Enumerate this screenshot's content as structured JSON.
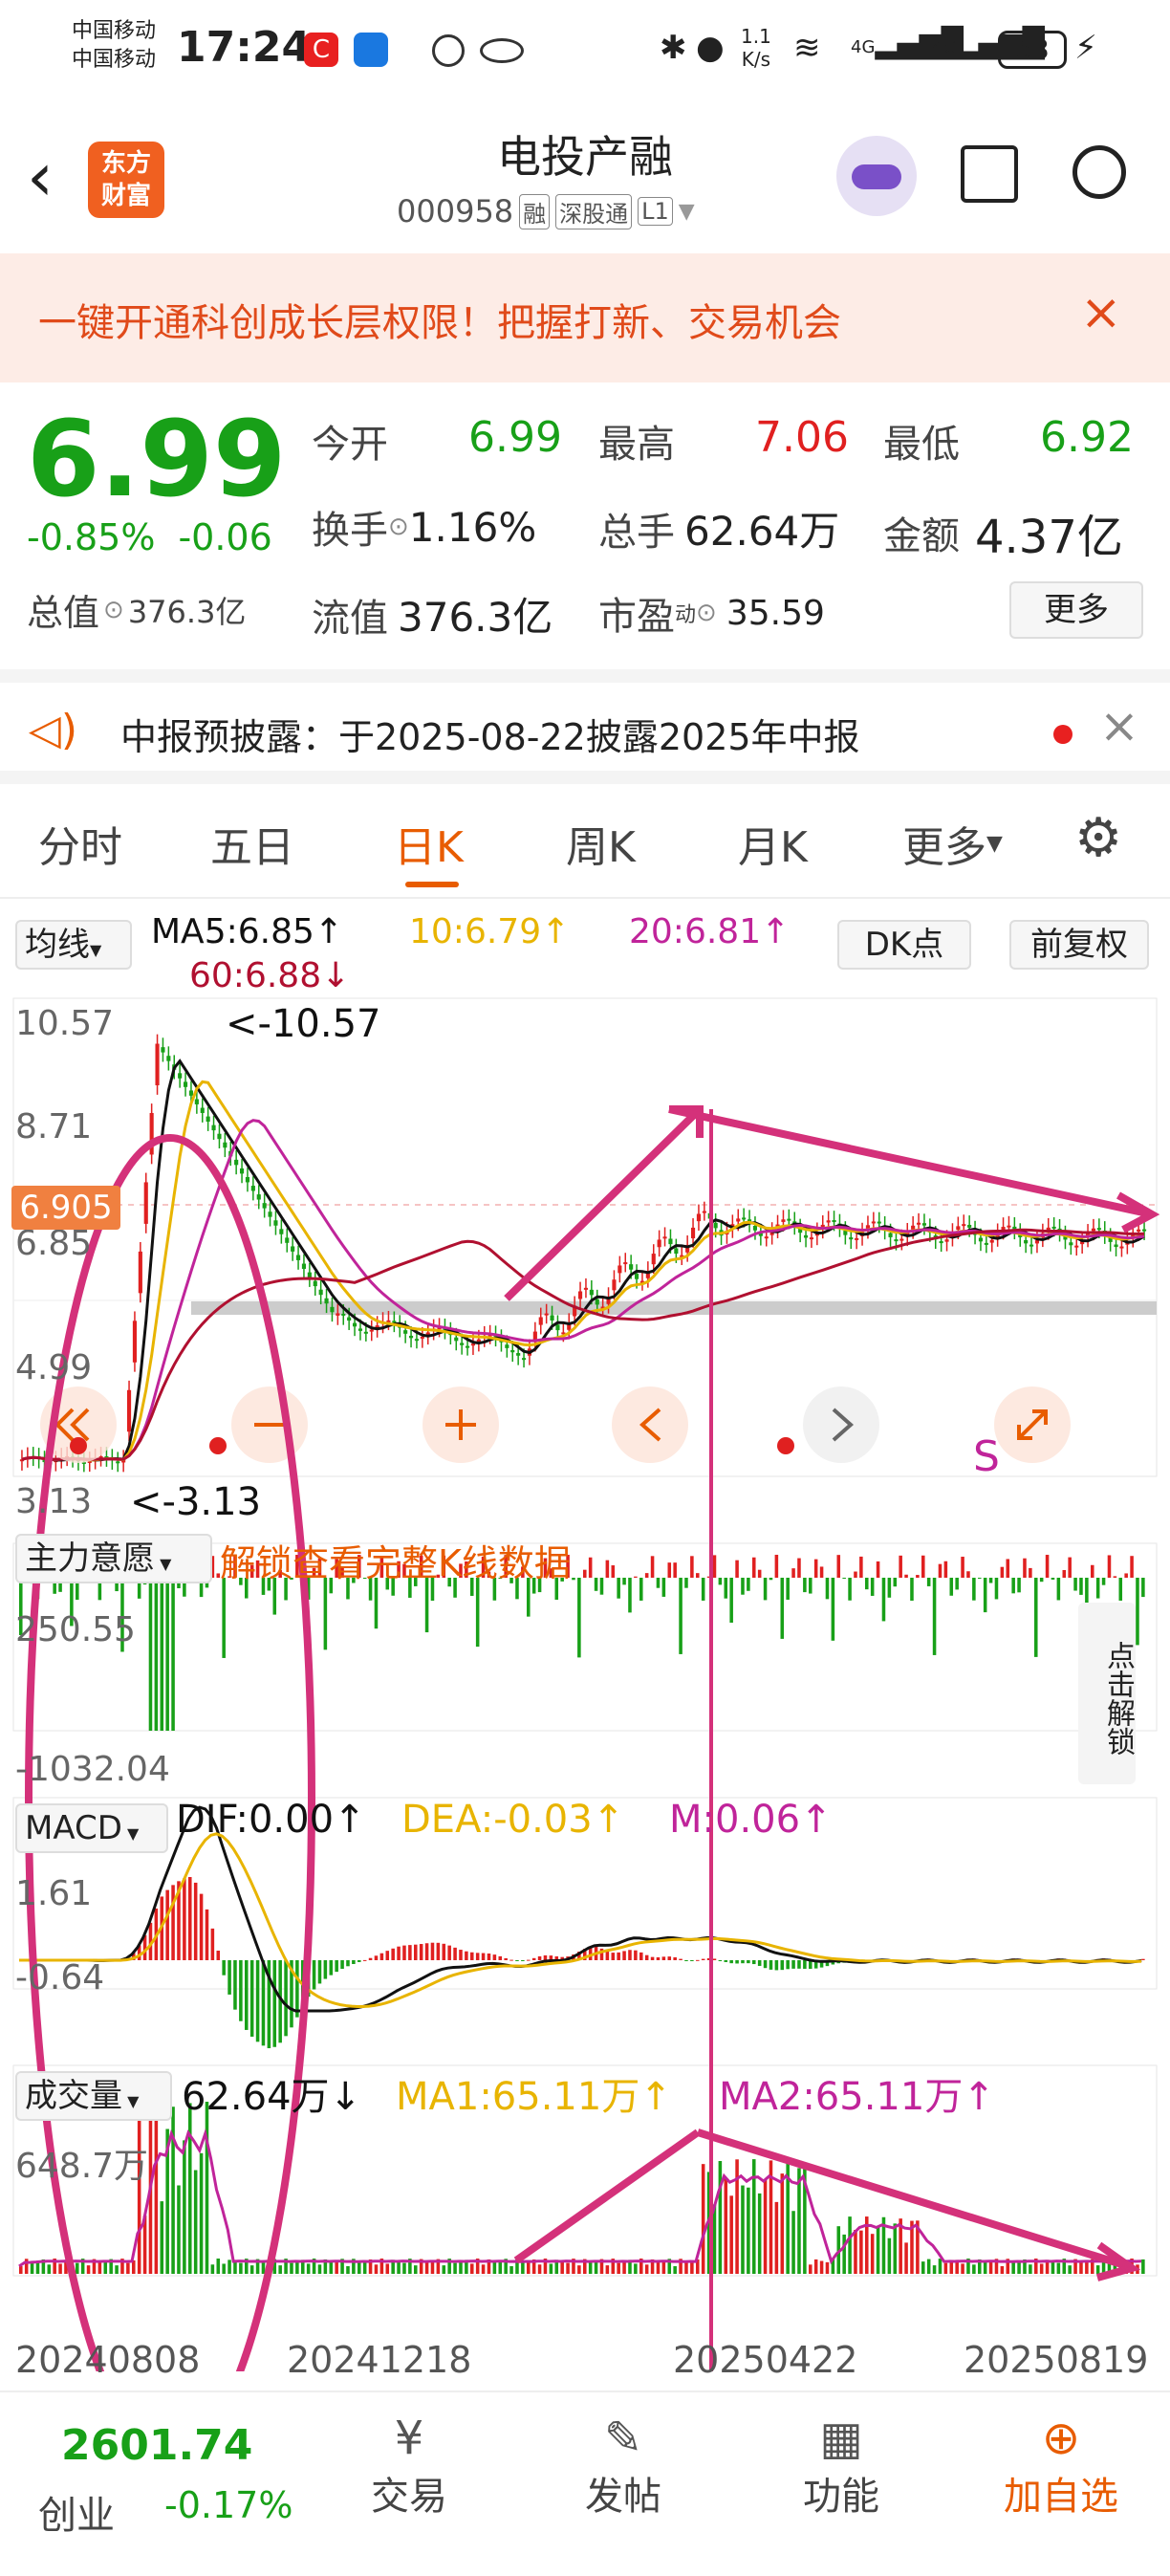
{
  "status": {
    "carrier1": "中国移动",
    "carrier2": "中国移动",
    "time": "17:24",
    "speed": "1.1",
    "speed_unit": "K/s",
    "battery": "53",
    "net1": "4G",
    "net2": "4G"
  },
  "nav": {
    "logo_line1": "东方",
    "logo_line2": "财富",
    "title": "电投产融",
    "code": "000958",
    "tag_rong": "融",
    "tag_hk": "深股通",
    "tag_l1": "L1"
  },
  "banner": {
    "text": "一键开通科创成长层权限！把握打新、交易机会"
  },
  "quote": {
    "price": "6.99",
    "change_pct": "-0.85%",
    "change": "-0.06",
    "open_label": "今开",
    "open": "6.99",
    "high_label": "最高",
    "high": "7.06",
    "low_label": "最低",
    "low": "6.92",
    "turnover_label": "换手",
    "turnover": "1.16%",
    "volume_label": "总手",
    "volume": "62.64万",
    "amount_label": "金额",
    "amount": "4.37亿",
    "mktcap_label": "总值",
    "mktcap": "376.3亿",
    "float_label": "流值",
    "float_cap": "376.3亿",
    "pe_label": "市盈",
    "pe_sup": "动",
    "pe": "35.59",
    "more": "更多"
  },
  "notice": {
    "text": "中报预披露：于2025-08-22披露2025年中报"
  },
  "tabs": [
    "分时",
    "五日",
    "日K",
    "周K",
    "月K",
    "更多"
  ],
  "active_tab": "日K",
  "ma_bar": {
    "select": "均线",
    "ma5": "MA5:6.85↑",
    "ma10": "10:6.79↑",
    "ma20": "20:6.81↑",
    "ma60": "60:6.88↓",
    "dk": "DK点",
    "adjust": "前复权"
  },
  "kline": {
    "y_top": "10.57",
    "y_mid1": "8.71",
    "y_mid2": "6.85",
    "y_low": "4.99",
    "y_bottom": "3.13",
    "max_label": "<-10.57",
    "min_label": "<-3.13",
    "price_tag": "6.905",
    "letter_s": "S"
  },
  "capital": {
    "select": "主力意愿",
    "unlock_text": "解锁查看完整K线数据",
    "y_top": "250.55",
    "y_bottom": "-1032.04",
    "side_btn": "点击解锁"
  },
  "macd": {
    "select": "MACD",
    "dif": "DIF:0.00↑",
    "dea": "DEA:-0.03↑",
    "m": "M:0.06↑",
    "y_top": "1.61",
    "y_bottom": "-0.64"
  },
  "vol": {
    "select": "成交量",
    "value": "62.64万↓",
    "ma1": "MA1:65.11万↑",
    "ma2": "MA2:65.11万↑",
    "y_top": "648.7万"
  },
  "dates": [
    "20240808",
    "20241218",
    "20250422",
    "20250819"
  ],
  "bottom": {
    "index_value": "2601.74",
    "index_name": "创业",
    "index_change": "-0.17%",
    "trade": "交易",
    "post": "发帖",
    "func": "功能",
    "add": "加自选"
  },
  "colors": {
    "up": "#e02020",
    "down": "#18a018",
    "ma5": "#111111",
    "ma10": "#e8b400",
    "ma20": "#c0249a",
    "ma60": "#b01030",
    "annotation": "#d4317a",
    "accent": "#e85c00"
  }
}
